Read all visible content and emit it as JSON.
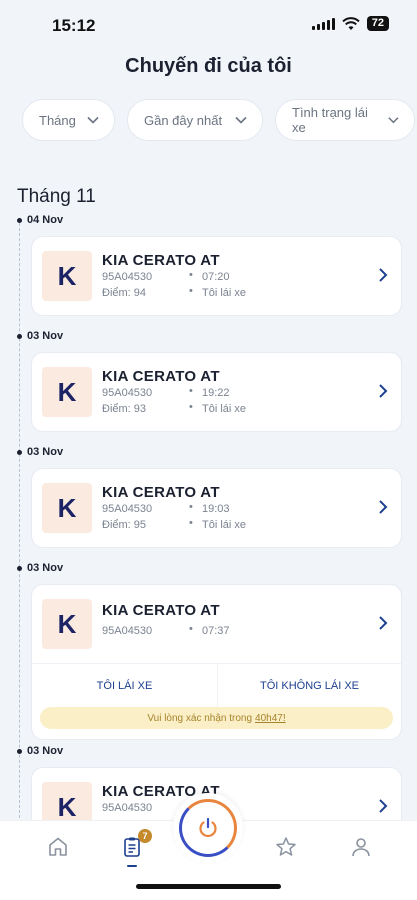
{
  "status": {
    "time": "15:12",
    "battery": "72"
  },
  "header": {
    "title": "Chuyến đi của tôi"
  },
  "filters": {
    "month": "Tháng",
    "sort": "Gần đây nhất",
    "driving_status": "Tình trạng lái xe"
  },
  "month_heading": "Tháng 11",
  "trips": [
    {
      "date": "04 Nov",
      "letter": "K",
      "car": "KIA CERATO AT",
      "plate": "95A04530",
      "score": "Điểm: 94",
      "time": "07:20",
      "driver": "Tôi lái xe",
      "sep": "•"
    },
    {
      "date": "03 Nov",
      "letter": "K",
      "car": "KIA CERATO AT",
      "plate": "95A04530",
      "score": "Điểm: 93",
      "time": "19:22",
      "driver": "Tôi lái xe",
      "sep": "•"
    },
    {
      "date": "03 Nov",
      "letter": "K",
      "car": "KIA CERATO AT",
      "plate": "95A04530",
      "score": "Điểm: 95",
      "time": "19:03",
      "driver": "Tôi lái xe",
      "sep": "•"
    },
    {
      "date": "03 Nov",
      "letter": "K",
      "car": "KIA CERATO AT",
      "plate": "95A04530",
      "time": "07:37",
      "sep": "•",
      "action_yes": "TÔI LÁI XE",
      "action_no": "TÔI KHÔNG LÁI XE",
      "notice_text": "Vui lòng xác nhận trong",
      "notice_time": "40h47!"
    },
    {
      "date": "03 Nov",
      "letter": "K",
      "car": "KIA CERATO AT",
      "plate": "95A04530"
    }
  ],
  "nav": {
    "trips_badge": "7"
  }
}
